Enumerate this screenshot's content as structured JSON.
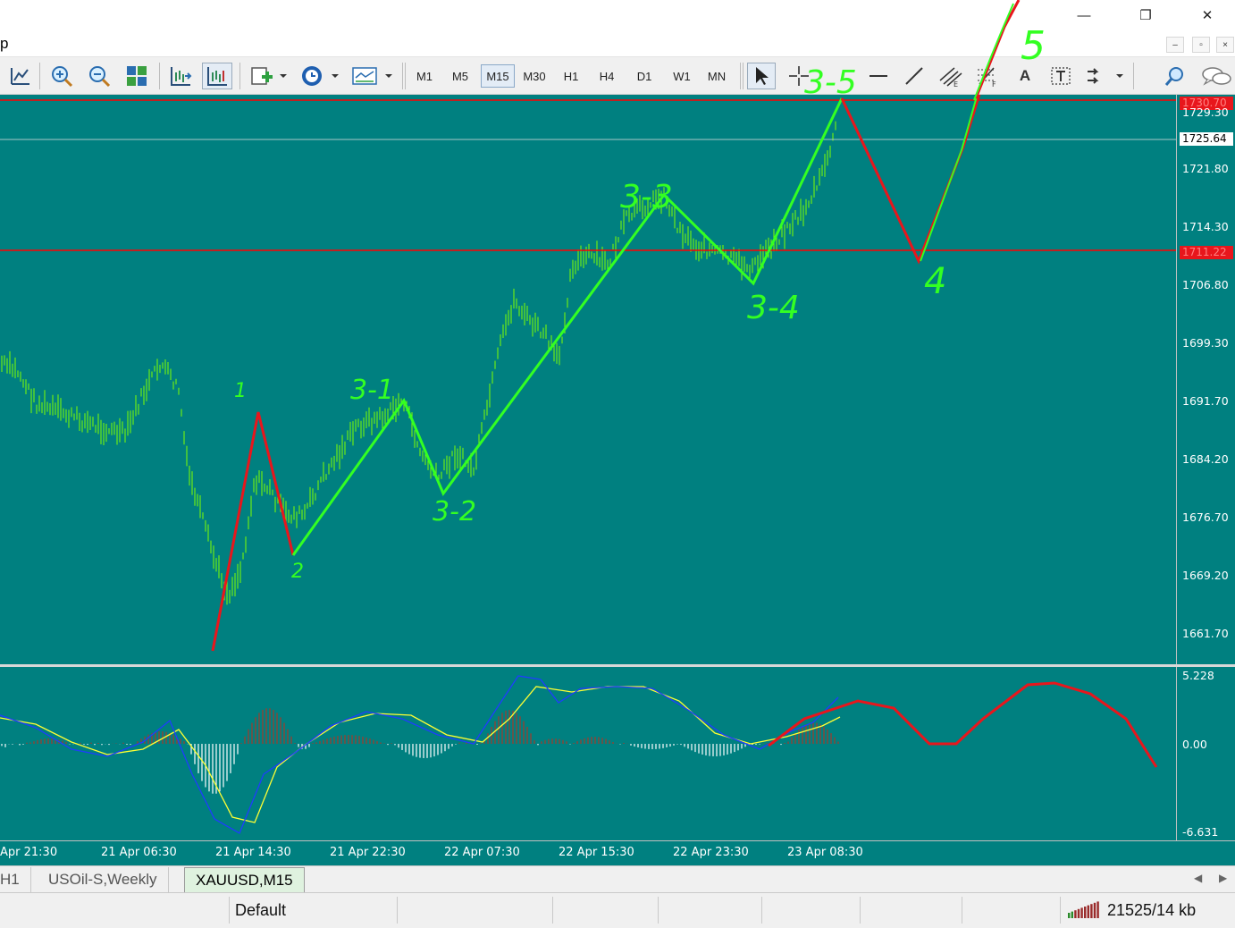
{
  "window": {
    "menu_letter": "p",
    "minimize_glyph": "—",
    "restore_glyph": "❐",
    "close_glyph": "✕",
    "mdi_minimize": "–",
    "mdi_restore": "▫",
    "mdi_close": "×"
  },
  "toolbar": {
    "timeframes": [
      "M1",
      "M5",
      "M15",
      "M30",
      "H1",
      "H4",
      "D1",
      "W1",
      "MN"
    ],
    "active_timeframe": "M15",
    "icons": [
      "line-chart-icon",
      "zoom-in-icon",
      "zoom-out-icon",
      "tile-windows-icon",
      "auto-scroll-icon",
      "chart-shift-icon",
      "indicators-icon",
      "periods-clock-icon",
      "templates-icon",
      "cursor-icon",
      "crosshair-icon",
      "horizontal-line-icon",
      "trend-line-icon",
      "equidistant-channel-icon",
      "fibonacci-icon",
      "text-icon",
      "text-label-icon",
      "arrows-icon",
      "search-icon",
      "chat-icon"
    ],
    "text_tool_glyph": "A"
  },
  "chart": {
    "symbol": "XAUUSD",
    "timeframe": "M15",
    "background": "#008080",
    "candle_color": "#7fff00",
    "price_ticks": [
      "1729.30",
      "1721.80",
      "1714.30",
      "1706.80",
      "1699.30",
      "1691.70",
      "1684.20",
      "1676.70",
      "1669.20",
      "1661.70"
    ],
    "current_price": "1725.64",
    "hline_top_price": "1730.70",
    "hline_mid_price": "1711.22",
    "hline_color": "#ff0000",
    "time_ticks": [
      "Apr 21:30",
      "21 Apr 06:30",
      "21 Apr 14:30",
      "21 Apr 22:30",
      "22 Apr 07:30",
      "22 Apr 15:30",
      "22 Apr 23:30",
      "23 Apr 08:30"
    ],
    "wave_labels": [
      "1",
      "2",
      "3-1",
      "3-2",
      "3-3",
      "3-4",
      "3-5",
      "4",
      "5"
    ],
    "indicator": {
      "name": "MACD",
      "ticks": [
        "5.228",
        "0.00",
        "-6.631"
      ]
    }
  },
  "tabs": [
    {
      "label": "H1",
      "active": false
    },
    {
      "label": "USOil-S,Weekly",
      "active": false
    },
    {
      "label": "XAUUSD,M15",
      "active": true
    }
  ],
  "status": {
    "profile": "Default",
    "traffic": "21525/14 kb"
  }
}
